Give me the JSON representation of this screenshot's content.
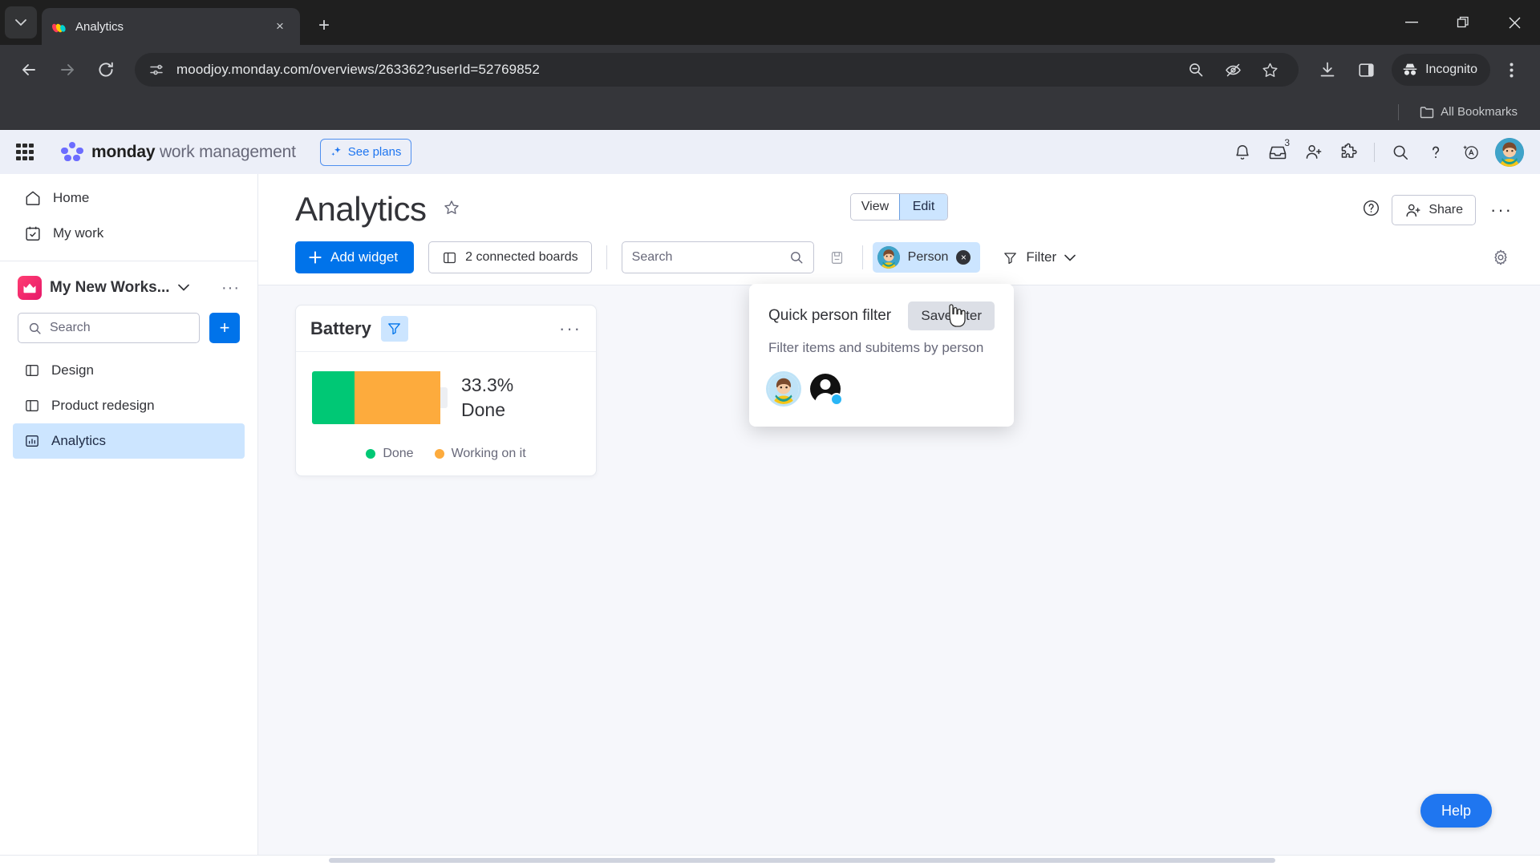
{
  "browser": {
    "tab": {
      "title": "Analytics",
      "favicon": "monday-logo-icon",
      "close": "×"
    },
    "newtab_label": "+",
    "tab_list_icon": "chevron-down-icon",
    "window": {
      "minimize": "—",
      "maximize": "❐",
      "close": "✕"
    },
    "nav": {
      "back": "←",
      "forward": "→",
      "reload": "⟳"
    },
    "omnibox": {
      "url": "moodjoy.monday.com/overviews/263362?userId=52769852",
      "site_settings_icon": "tune-icon",
      "zoom_out_icon": "zoom-out-icon",
      "hide_password_icon": "eye-slash-icon",
      "bookmark_icon": "star-icon",
      "download_icon": "download-icon",
      "side_panel_icon": "side-panel-icon",
      "menu_icon": "kebab-menu-icon"
    },
    "incognito_label": "Incognito",
    "bookmarks": {
      "all_label": "All Bookmarks",
      "folder_icon": "folder-icon"
    }
  },
  "app_header": {
    "apps_grid_icon": "apps-grid-icon",
    "brand_bold": "monday",
    "brand_rest": " work management",
    "see_plans_label": "See plans",
    "see_plans_icon": "sparkle-icon",
    "icons": [
      {
        "name": "notifications-bell-icon",
        "glyph": "bell"
      },
      {
        "name": "inbox-icon",
        "glyph": "inbox",
        "badge": "3"
      },
      {
        "name": "invite-member-icon",
        "glyph": "person-plus"
      },
      {
        "name": "apps-marketplace-icon",
        "glyph": "puzzle"
      },
      {
        "name": "search-icon",
        "glyph": "search"
      },
      {
        "name": "help-icon",
        "glyph": "question"
      },
      {
        "name": "ai-assistant-icon",
        "glyph": "ai"
      }
    ]
  },
  "sidebar": {
    "nav": [
      {
        "label": "Home",
        "icon": "home-icon"
      },
      {
        "label": "My work",
        "icon": "my-work-icon"
      }
    ],
    "workspace": {
      "name": "My New Works...",
      "chevron": "⌄",
      "more": "···",
      "icon": "workspace-icon"
    },
    "search": {
      "placeholder": "Search",
      "icon": "search-icon"
    },
    "add_label": "+",
    "boards": [
      {
        "label": "Design",
        "icon": "board-icon",
        "active": false
      },
      {
        "label": "Product redesign",
        "icon": "board-icon",
        "active": false
      },
      {
        "label": "Analytics",
        "icon": "dashboard-icon",
        "active": true
      }
    ]
  },
  "main": {
    "title": "Analytics",
    "star_icon": "star-outline-icon",
    "view_toggle": {
      "view": "View",
      "edit": "Edit",
      "active": "Edit"
    },
    "help_icon": "question-circle-icon",
    "share_label": "Share",
    "share_icon": "person-plus-icon",
    "more_label": "···",
    "toolbar": {
      "add_widget_label": "Add widget",
      "add_widget_icon": "plus-icon",
      "connected_boards_label": "2 connected boards",
      "connected_boards_icon": "board-icon",
      "search_placeholder": "Search",
      "search_icon": "search-icon",
      "save_icon": "save-disk-icon",
      "person_chip_label": "Person",
      "person_chip_remove": "×",
      "filter_label": "Filter",
      "filter_icon": "funnel-icon",
      "filter_chevron": "⌄",
      "settings_icon": "gear-icon"
    }
  },
  "widget": {
    "title": "Battery",
    "filter_icon": "funnel-icon",
    "menu": "···",
    "percent_label": "33.3%",
    "status_label": "Done"
  },
  "chart_data": {
    "type": "bar",
    "title": "Battery",
    "categories": [
      "Done",
      "Working on it"
    ],
    "values": [
      33.3,
      66.7
    ],
    "colors": [
      "#00c875",
      "#fdab3d"
    ],
    "unit": "%",
    "center_value": "33.3%",
    "center_label": "Done",
    "legend_position": "bottom",
    "grid": false,
    "xlabel": "",
    "ylabel": ""
  },
  "popup": {
    "title": "Quick person filter",
    "save_button": "Save filter",
    "subtitle": "Filter items and subitems by person",
    "avatars": [
      {
        "name": "avatar-user-photo",
        "selected": true
      },
      {
        "name": "avatar-generic-person",
        "selected": false
      }
    ]
  },
  "help_button": {
    "label": "Help"
  },
  "colors": {
    "accent_blue": "#0073ea",
    "done_green": "#00c875",
    "working_orange": "#fdab3d",
    "chip_blue": "#cce5ff",
    "header_bg": "#eceff8",
    "canvas_bg": "#f6f7fb"
  }
}
